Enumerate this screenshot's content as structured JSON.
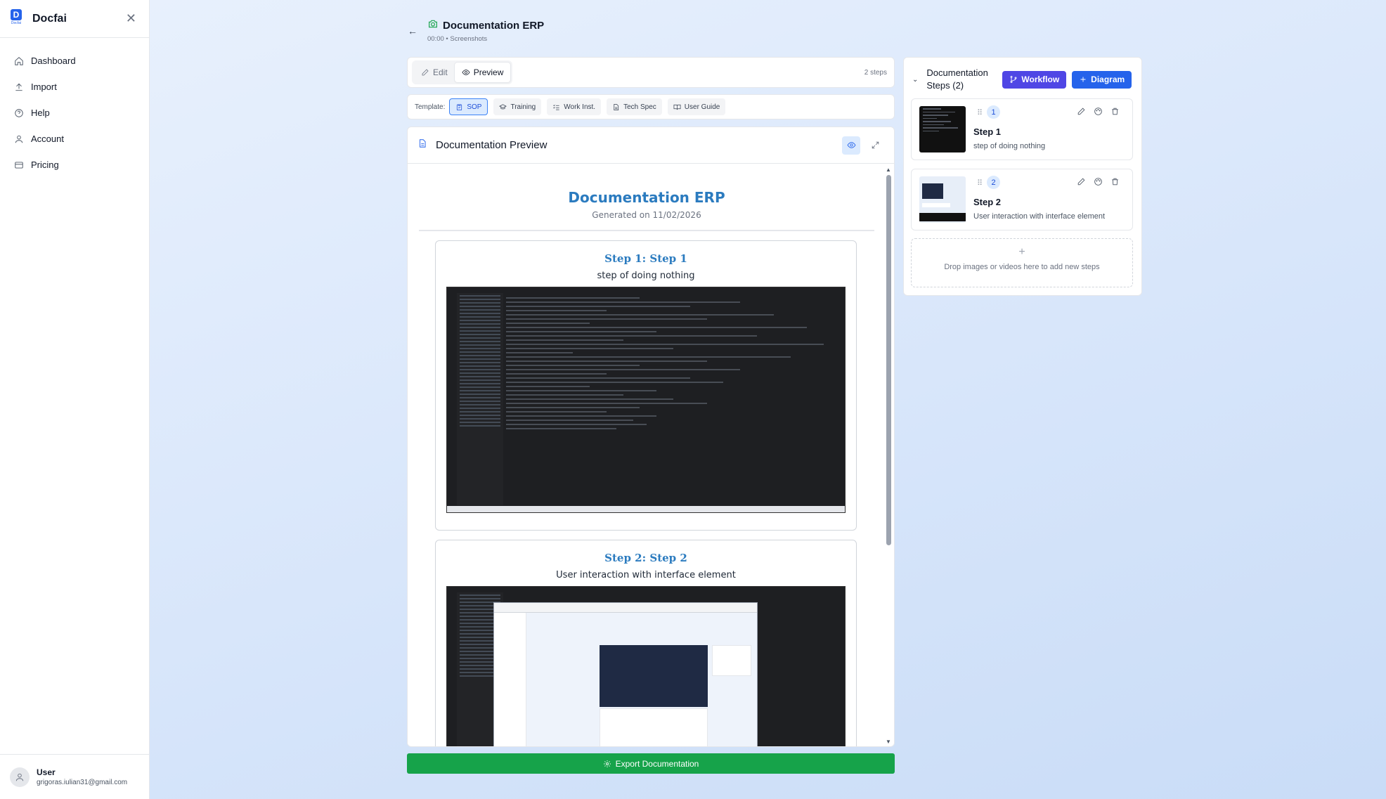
{
  "app": {
    "name": "Docfai",
    "logo_letter": "D",
    "logo_sub": "Docfai"
  },
  "sidebar": {
    "items": [
      {
        "label": "Dashboard",
        "icon": "home-icon"
      },
      {
        "label": "Import",
        "icon": "upload-icon"
      },
      {
        "label": "Help",
        "icon": "help-circle-icon"
      },
      {
        "label": "Account",
        "icon": "user-icon"
      },
      {
        "label": "Pricing",
        "icon": "credit-card-icon"
      }
    ],
    "user": {
      "name": "User",
      "email": "grigoras.iulian31@gmail.com"
    }
  },
  "header": {
    "title": "Documentation ERP",
    "subtitle": "00:00 • Screenshots"
  },
  "tabs": {
    "edit": "Edit",
    "preview": "Preview",
    "active": "Preview",
    "steps_count": "2 steps"
  },
  "templates": {
    "label": "Template:",
    "options": [
      "SOP",
      "Training",
      "Work Inst.",
      "Tech Spec",
      "User Guide"
    ],
    "selected": "SOP"
  },
  "preview": {
    "title": "Documentation Preview",
    "doc_title": "Documentation ERP",
    "generated": "Generated on 11/02/2026",
    "steps": [
      {
        "title": "Step 1: Step 1",
        "desc": "step of doing nothing"
      },
      {
        "title": "Step 2: Step 2",
        "desc": "User interaction with interface element"
      }
    ]
  },
  "export_label": "Export Documentation",
  "steps_panel": {
    "title": "Documentation Steps (2)",
    "workflow_label": "Workflow",
    "diagram_label": "Diagram",
    "steps": [
      {
        "number": "1",
        "title": "Step 1",
        "desc": "step of doing nothing"
      },
      {
        "number": "2",
        "title": "Step 2",
        "desc": "User interaction with interface element"
      }
    ],
    "dropzone_text": "Drop images or videos here to add new steps"
  },
  "colors": {
    "accent": "#2563eb",
    "workflow": "#4f46e5",
    "export": "#16a34a",
    "doc_heading": "#2b7bbf"
  }
}
